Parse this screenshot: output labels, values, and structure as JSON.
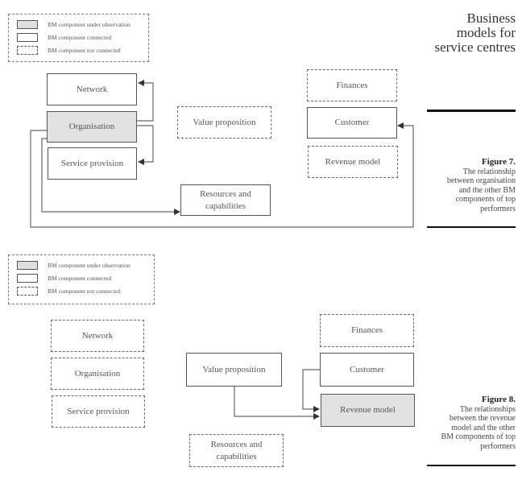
{
  "running_head": [
    "Business",
    "models for",
    "service centres"
  ],
  "legend": {
    "under_observation": "BM component under observation",
    "connected": "BM component connected",
    "not_connected": "BM component not connected"
  },
  "figure7": {
    "label": "Figure 7.",
    "caption": [
      "The relationship",
      "between organisation",
      "and the other BM",
      "components of top",
      "performers"
    ],
    "components": {
      "network": {
        "label": "Network",
        "status": "connected"
      },
      "organisation": {
        "label": "Organisation",
        "status": "under_observation"
      },
      "service_provision": {
        "label": "Service provision",
        "status": "connected"
      },
      "value_proposition": {
        "label": "Value proposition",
        "status": "not_connected"
      },
      "resources": {
        "label": "Resources and capabilities",
        "line1": "Resources and",
        "line2": "capabilities",
        "status": "connected"
      },
      "finances": {
        "label": "Finances",
        "status": "not_connected"
      },
      "customer": {
        "label": "Customer",
        "status": "connected"
      },
      "revenue_model": {
        "label": "Revenue model",
        "status": "not_connected"
      }
    },
    "connections": [
      [
        "Organisation",
        "Network"
      ],
      [
        "Organisation",
        "Service provision"
      ],
      [
        "Organisation",
        "Resources and capabilities"
      ],
      [
        "Organisation",
        "Customer"
      ]
    ]
  },
  "figure8": {
    "label": "Figure 8.",
    "caption": [
      "The relationships",
      "between the revenue",
      "model and the other",
      "BM components of top",
      "performers"
    ],
    "components": {
      "network": {
        "label": "Network",
        "status": "not_connected"
      },
      "organisation": {
        "label": "Organisation",
        "status": "not_connected"
      },
      "service_provision": {
        "label": "Service provision",
        "status": "not_connected"
      },
      "value_proposition": {
        "label": "Value proposition",
        "status": "connected"
      },
      "resources": {
        "label": "Resources and capabilities",
        "line1": "Resources and",
        "line2": "capabilities",
        "status": "not_connected"
      },
      "finances": {
        "label": "Finances",
        "status": "not_connected"
      },
      "customer": {
        "label": "Customer",
        "status": "connected"
      },
      "revenue_model": {
        "label": "Revenue model",
        "status": "under_observation"
      }
    },
    "connections": [
      [
        "Customer",
        "Revenue model"
      ],
      [
        "Value proposition",
        "Revenue model"
      ]
    ]
  }
}
